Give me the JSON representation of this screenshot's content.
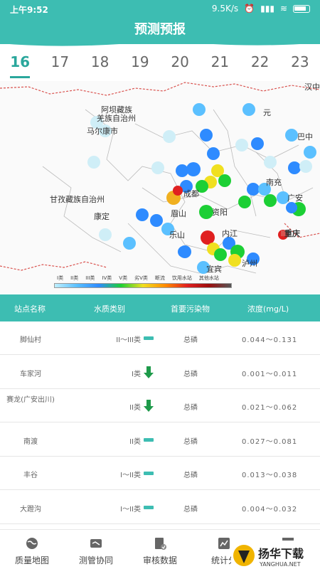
{
  "status": {
    "time": "上午9:52",
    "net_speed": "9.5K/s"
  },
  "header": {
    "title": "预测预报"
  },
  "date_tabs": [
    "16",
    "17",
    "18",
    "19",
    "20",
    "21",
    "22",
    "23"
  ],
  "active_tab": "16",
  "map": {
    "places": [
      "阿坝藏族",
      "羌族自治州",
      "马尔康市",
      "甘孜藏族自治州",
      "康定",
      "成都",
      "眉山",
      "乐山",
      "资阳",
      "内江",
      "宜宾",
      "泸州",
      "南充",
      "广安",
      "重庆",
      "巴中",
      "汉中",
      "元"
    ]
  },
  "legend": [
    "I类",
    "II类",
    "III类",
    "IV类",
    "V类",
    "劣V类",
    "断流",
    "饮用水站",
    "其他水站"
  ],
  "table": {
    "headers": [
      "站点名称",
      "水质类别",
      "首要污染物",
      "浓度(mg/L)"
    ],
    "rows": [
      {
        "name": "脚仙村",
        "grade": "II～III类",
        "trend": "flat",
        "pollutant": "总磷",
        "conc": "0.044～0.131"
      },
      {
        "name": "车家河",
        "grade": "I类",
        "trend": "down",
        "pollutant": "总磷",
        "conc": "0.001～0.011"
      },
      {
        "name": "赛龙(广安出川)",
        "grade": "II类",
        "trend": "down",
        "pollutant": "总磷",
        "conc": "0.021～0.062"
      },
      {
        "name": "南渡",
        "grade": "II类",
        "trend": "flat",
        "pollutant": "总磷",
        "conc": "0.027～0.081"
      },
      {
        "name": "丰谷",
        "grade": "I～II类",
        "trend": "flat",
        "pollutant": "总磷",
        "conc": "0.013～0.038"
      },
      {
        "name": "大蹬沟",
        "grade": "I～II类",
        "trend": "flat",
        "pollutant": "总磷",
        "conc": "0.004～0.032"
      }
    ]
  },
  "nav": [
    "质量地图",
    "测管协同",
    "审核数据",
    "统计分"
  ],
  "watermark": {
    "main": "扬华下载",
    "sub": "YANGHUA.NET"
  },
  "colors": {
    "accent": "#3dbdb2",
    "active_tab": "#2aa79c",
    "trend_down": "#1e9a4a"
  }
}
